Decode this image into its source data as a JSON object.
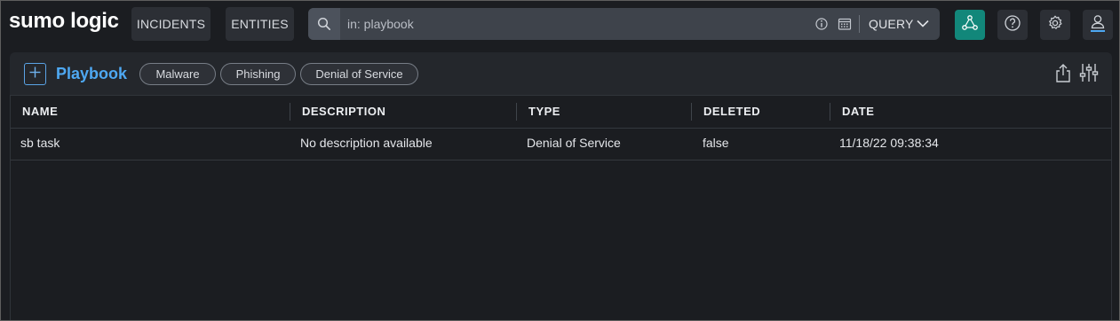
{
  "app": {
    "logo": "sumo logic"
  },
  "nav": {
    "incidents": "INCIDENTS",
    "entities": "ENTITIES"
  },
  "search": {
    "value": "in: playbook",
    "query_label": "QUERY"
  },
  "toolbar_icons": [
    "network-icon",
    "help-icon",
    "settings-icon",
    "user-icon"
  ],
  "colors": {
    "accent": "#12877a",
    "title_blue": "#4ea8f2",
    "background": "#1b1d21"
  },
  "panel": {
    "title": "Playbook",
    "filters": [
      "Malware",
      "Phishing",
      "Denial of Service"
    ]
  },
  "table": {
    "columns": [
      "NAME",
      "DESCRIPTION",
      "TYPE",
      "DELETED",
      "DATE"
    ],
    "rows": [
      [
        "sb task",
        "No description available",
        "Denial of Service",
        "false",
        "11/18/22 09:38:34"
      ]
    ]
  }
}
